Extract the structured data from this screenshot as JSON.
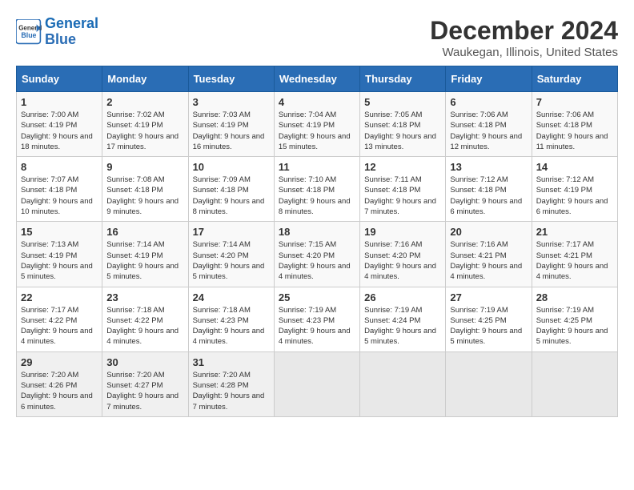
{
  "header": {
    "logo_line1": "General",
    "logo_line2": "Blue",
    "title": "December 2024",
    "subtitle": "Waukegan, Illinois, United States"
  },
  "weekdays": [
    "Sunday",
    "Monday",
    "Tuesday",
    "Wednesday",
    "Thursday",
    "Friday",
    "Saturday"
  ],
  "weeks": [
    [
      {
        "day": "1",
        "info": "Sunrise: 7:00 AM\nSunset: 4:19 PM\nDaylight: 9 hours and 18 minutes."
      },
      {
        "day": "2",
        "info": "Sunrise: 7:02 AM\nSunset: 4:19 PM\nDaylight: 9 hours and 17 minutes."
      },
      {
        "day": "3",
        "info": "Sunrise: 7:03 AM\nSunset: 4:19 PM\nDaylight: 9 hours and 16 minutes."
      },
      {
        "day": "4",
        "info": "Sunrise: 7:04 AM\nSunset: 4:19 PM\nDaylight: 9 hours and 15 minutes."
      },
      {
        "day": "5",
        "info": "Sunrise: 7:05 AM\nSunset: 4:18 PM\nDaylight: 9 hours and 13 minutes."
      },
      {
        "day": "6",
        "info": "Sunrise: 7:06 AM\nSunset: 4:18 PM\nDaylight: 9 hours and 12 minutes."
      },
      {
        "day": "7",
        "info": "Sunrise: 7:06 AM\nSunset: 4:18 PM\nDaylight: 9 hours and 11 minutes."
      }
    ],
    [
      {
        "day": "8",
        "info": "Sunrise: 7:07 AM\nSunset: 4:18 PM\nDaylight: 9 hours and 10 minutes."
      },
      {
        "day": "9",
        "info": "Sunrise: 7:08 AM\nSunset: 4:18 PM\nDaylight: 9 hours and 9 minutes."
      },
      {
        "day": "10",
        "info": "Sunrise: 7:09 AM\nSunset: 4:18 PM\nDaylight: 9 hours and 8 minutes."
      },
      {
        "day": "11",
        "info": "Sunrise: 7:10 AM\nSunset: 4:18 PM\nDaylight: 9 hours and 8 minutes."
      },
      {
        "day": "12",
        "info": "Sunrise: 7:11 AM\nSunset: 4:18 PM\nDaylight: 9 hours and 7 minutes."
      },
      {
        "day": "13",
        "info": "Sunrise: 7:12 AM\nSunset: 4:18 PM\nDaylight: 9 hours and 6 minutes."
      },
      {
        "day": "14",
        "info": "Sunrise: 7:12 AM\nSunset: 4:19 PM\nDaylight: 9 hours and 6 minutes."
      }
    ],
    [
      {
        "day": "15",
        "info": "Sunrise: 7:13 AM\nSunset: 4:19 PM\nDaylight: 9 hours and 5 minutes."
      },
      {
        "day": "16",
        "info": "Sunrise: 7:14 AM\nSunset: 4:19 PM\nDaylight: 9 hours and 5 minutes."
      },
      {
        "day": "17",
        "info": "Sunrise: 7:14 AM\nSunset: 4:20 PM\nDaylight: 9 hours and 5 minutes."
      },
      {
        "day": "18",
        "info": "Sunrise: 7:15 AM\nSunset: 4:20 PM\nDaylight: 9 hours and 4 minutes."
      },
      {
        "day": "19",
        "info": "Sunrise: 7:16 AM\nSunset: 4:20 PM\nDaylight: 9 hours and 4 minutes."
      },
      {
        "day": "20",
        "info": "Sunrise: 7:16 AM\nSunset: 4:21 PM\nDaylight: 9 hours and 4 minutes."
      },
      {
        "day": "21",
        "info": "Sunrise: 7:17 AM\nSunset: 4:21 PM\nDaylight: 9 hours and 4 minutes."
      }
    ],
    [
      {
        "day": "22",
        "info": "Sunrise: 7:17 AM\nSunset: 4:22 PM\nDaylight: 9 hours and 4 minutes."
      },
      {
        "day": "23",
        "info": "Sunrise: 7:18 AM\nSunset: 4:22 PM\nDaylight: 9 hours and 4 minutes."
      },
      {
        "day": "24",
        "info": "Sunrise: 7:18 AM\nSunset: 4:23 PM\nDaylight: 9 hours and 4 minutes."
      },
      {
        "day": "25",
        "info": "Sunrise: 7:19 AM\nSunset: 4:23 PM\nDaylight: 9 hours and 4 minutes."
      },
      {
        "day": "26",
        "info": "Sunrise: 7:19 AM\nSunset: 4:24 PM\nDaylight: 9 hours and 5 minutes."
      },
      {
        "day": "27",
        "info": "Sunrise: 7:19 AM\nSunset: 4:25 PM\nDaylight: 9 hours and 5 minutes."
      },
      {
        "day": "28",
        "info": "Sunrise: 7:19 AM\nSunset: 4:25 PM\nDaylight: 9 hours and 5 minutes."
      }
    ],
    [
      {
        "day": "29",
        "info": "Sunrise: 7:20 AM\nSunset: 4:26 PM\nDaylight: 9 hours and 6 minutes."
      },
      {
        "day": "30",
        "info": "Sunrise: 7:20 AM\nSunset: 4:27 PM\nDaylight: 9 hours and 7 minutes."
      },
      {
        "day": "31",
        "info": "Sunrise: 7:20 AM\nSunset: 4:28 PM\nDaylight: 9 hours and 7 minutes."
      },
      null,
      null,
      null,
      null
    ]
  ]
}
